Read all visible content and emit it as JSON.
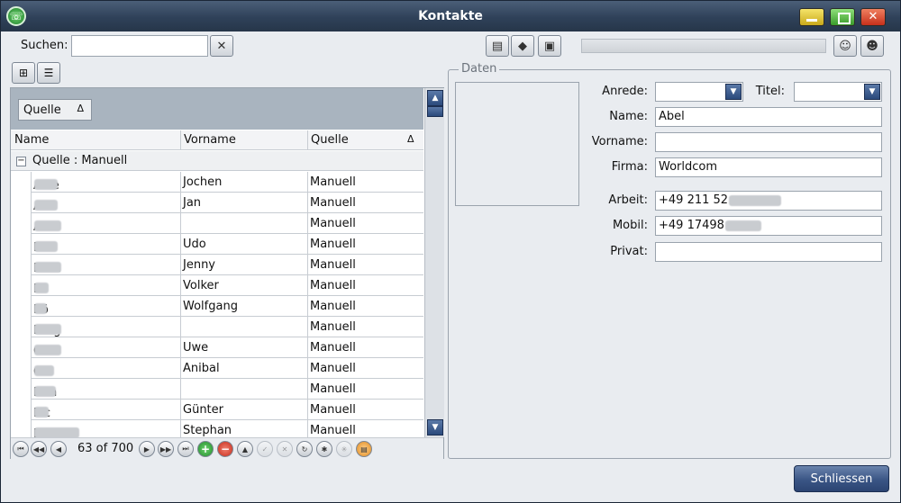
{
  "window": {
    "title": "Kontakte"
  },
  "toolbar": {
    "search_label": "Suchen:",
    "search_value": "",
    "search_placeholder": ""
  },
  "grid": {
    "group_chip": "Quelle",
    "sort_indicator": "Δ",
    "columns": [
      "Name",
      "Vorname",
      "Quelle"
    ],
    "group_row": "Quelle : Manuell",
    "rows": [
      {
        "name": "Albe",
        "vorname": "Jochen",
        "quelle": "Manuell"
      },
      {
        "name": "Ant",
        "vorname": "Jan",
        "quelle": "Manuell"
      },
      {
        "name": "Art",
        "vorname": "",
        "quelle": "Manuell"
      },
      {
        "name": "Bei",
        "vorname": "Udo",
        "quelle": "Manuell"
      },
      {
        "name": "Boet",
        "vorname": "Jenny",
        "quelle": "Manuell"
      },
      {
        "name": "Bo",
        "vorname": "Volker",
        "quelle": "Manuell"
      },
      {
        "name": "Bö",
        "vorname": "Wolfgang",
        "quelle": "Manuell"
      },
      {
        "name": "Burg",
        "vorname": "",
        "quelle": "Manuell"
      },
      {
        "name": "Cas",
        "vorname": "Uwe",
        "quelle": "Manuell"
      },
      {
        "name": "Col",
        "vorname": "Anibal",
        "quelle": "Manuell"
      },
      {
        "name": "Don",
        "vorname": "",
        "quelle": "Manuell"
      },
      {
        "name": "Eic",
        "vorname": "Günter",
        "quelle": "Manuell"
      },
      {
        "name": "Engel",
        "vorname": "Stephan",
        "quelle": "Manuell"
      }
    ]
  },
  "navigator": {
    "position": "63 of 700"
  },
  "details": {
    "legend": "Daten",
    "anrede_label": "Anrede:",
    "anrede_value": "",
    "titel_label": "Titel:",
    "titel_value": "",
    "name_label": "Name:",
    "name_value": "Abel",
    "vorname_label": "Vorname:",
    "vorname_value": "",
    "firma_label": "Firma:",
    "firma_value": "Worldcom",
    "arbeit_label": "Arbeit:",
    "arbeit_value": "+49 211 52",
    "mobil_label": "Mobil:",
    "mobil_value": "+49 17498",
    "privat_label": "Privat:",
    "privat_value": ""
  },
  "footer": {
    "close_label": "Schliessen"
  }
}
